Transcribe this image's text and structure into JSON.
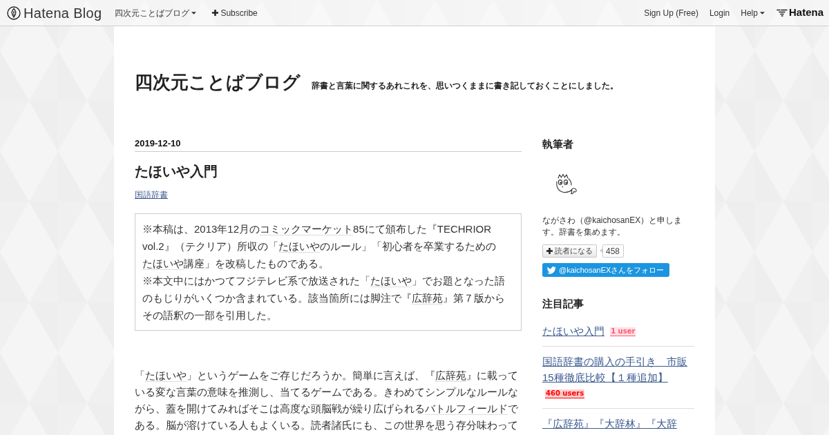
{
  "navbar": {
    "logo": "Hatena Blog",
    "blog_menu": "四次元ことばブログ",
    "subscribe": "Subscribe",
    "links": [
      {
        "label": "Sign Up (Free)",
        "kind": "link"
      },
      {
        "label": "Login",
        "kind": "link"
      },
      {
        "label": "Help",
        "kind": "dropdown"
      }
    ],
    "brand": "Hatena"
  },
  "header": {
    "title": "四次元ことばブログ",
    "description": "辞書と言葉に関するあれこれを、思いつくままに書き記しておくことにしました。"
  },
  "entry": {
    "date": "2019-12-10",
    "title": "たほいや入門",
    "categories": [
      "国語辞書"
    ],
    "note": [
      [
        {
          "kind": "text",
          "text": "※本稿は、2013年12月の"
        },
        {
          "kind": "keyword",
          "text": "コミックマーケット"
        },
        {
          "kind": "text",
          "text": "85にて頒布した『TECHRIOR vol.2』（テクリア）所収の「"
        },
        {
          "kind": "keyword",
          "text": "たほいや"
        },
        {
          "kind": "text",
          "text": "のルール」「初心者を卒業するための"
        },
        {
          "kind": "keyword",
          "text": "たほいや"
        },
        {
          "kind": "text",
          "text": "講座」を改稿したものである。"
        }
      ],
      [
        {
          "kind": "text",
          "text": "※本文中にはかつてフジテレビ系で放送された「"
        },
        {
          "kind": "keyword",
          "text": "たほいや"
        },
        {
          "kind": "text",
          "text": "」でお題となった語のもじりがいくつか含まれている。該当箇所には脚注で『"
        },
        {
          "kind": "keyword",
          "text": "広辞苑"
        },
        {
          "kind": "text",
          "text": "』第７版からその語釈の一部を引用した。"
        }
      ]
    ],
    "body": [
      [
        {
          "kind": "text",
          "text": "「"
        },
        {
          "kind": "keyword",
          "text": "たほいや"
        },
        {
          "kind": "text",
          "text": "」というゲームをご存じだろうか。簡単に言えば、『"
        },
        {
          "kind": "keyword",
          "text": "広辞苑"
        },
        {
          "kind": "text",
          "text": "』に載っている変な言葉の意味を推測し、当てるゲームである。きわめてシンプルなルールながら、蓋を開けてみればそこは高度な頭脳戦が繰り広げられる"
        },
        {
          "kind": "keyword",
          "text": "バトルフィールド"
        },
        {
          "kind": "text",
          "text": "である。脳が溶けている人もよくいる。読者諸氏にも、この世界を思う存分味わって"
        }
      ]
    ]
  },
  "sidebar": {
    "profile": {
      "heading": "執筆者",
      "bio": "ながさわ（@kaichosanEX）と申します。辞書を集めます。",
      "subscribe_button": "読者になる",
      "subscriber_count": "458",
      "twitter_button": "@kaichosanEXさんをフォロー"
    },
    "featured": {
      "heading": "注目記事",
      "articles": [
        {
          "title": "たほいや入門",
          "bookmarks": "1 user",
          "color": "#ff5a73"
        },
        {
          "title": "国語辞書の購入の手引き　市販15種徹底比較【１種追加】",
          "bookmarks": "460 users",
          "color": "#ff0000"
        },
        {
          "title": "『広辞苑』『大辞林』『大辞"
        }
      ]
    }
  }
}
